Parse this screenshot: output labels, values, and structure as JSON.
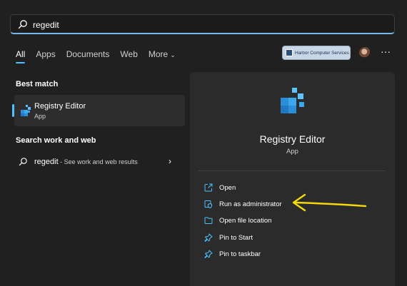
{
  "search": {
    "value": "regedit"
  },
  "tabs": [
    {
      "label": "All"
    },
    {
      "label": "Apps"
    },
    {
      "label": "Documents"
    },
    {
      "label": "Web"
    },
    {
      "label": "More"
    }
  ],
  "header": {
    "org_label": "Harbor Computer Services"
  },
  "left": {
    "best_match_title": "Best match",
    "best_match": {
      "name": "Registry Editor",
      "type": "App"
    },
    "web_title": "Search work and web",
    "web_query": "regedit",
    "web_suffix": " - See work and web results"
  },
  "right": {
    "name": "Registry Editor",
    "type": "App",
    "actions": [
      {
        "label": "Open",
        "icon": "open-icon"
      },
      {
        "label": "Run as administrator",
        "icon": "shield-icon"
      },
      {
        "label": "Open file location",
        "icon": "folder-icon"
      },
      {
        "label": "Pin to Start",
        "icon": "pin-icon"
      },
      {
        "label": "Pin to taskbar",
        "icon": "pin-icon"
      }
    ]
  },
  "colors": {
    "accent": "#4cc2ff",
    "annotation": "#f5d90a",
    "background": "#202020",
    "panel": "#2b2b2b"
  }
}
